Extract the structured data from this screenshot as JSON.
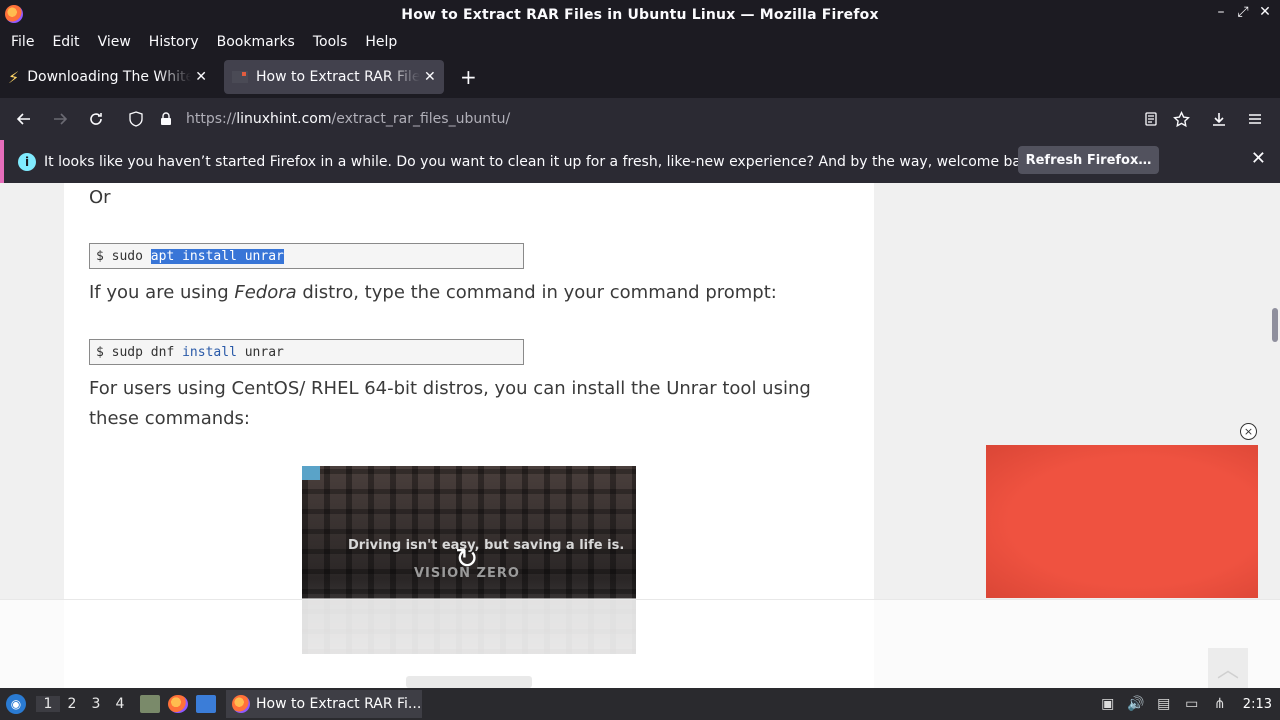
{
  "window": {
    "title": "How to Extract RAR Files in Ubuntu Linux — Mozilla Firefox",
    "buttons": {
      "minimize": "–",
      "maximize": "⤢",
      "close": "✕"
    }
  },
  "menubar": [
    "File",
    "Edit",
    "View",
    "History",
    "Bookmarks",
    "Tools",
    "Help"
  ],
  "tabs": [
    {
      "label": "Downloading The White House",
      "favicon": "bolt-icon",
      "active": false
    },
    {
      "label": "How to Extract RAR Files in Ubuntu",
      "favicon": "linuxhint-favicon",
      "active": true
    }
  ],
  "new_tab": "+",
  "url": {
    "scheme": "https://",
    "host": "linuxhint.com",
    "path": "/extract_rar_files_ubuntu/"
  },
  "notification": {
    "message": "It looks like you haven’t started Firefox in a while. Do you want to clean it up for a fresh, like-new experience? And by the way, welcome back!",
    "button": "Refresh Firefox…",
    "close": "✕"
  },
  "article": {
    "or_text": "Or",
    "code1": {
      "prompt": "$",
      "cmd": "sudo",
      "selected": "apt install unrar"
    },
    "fedora": {
      "before": "If you are using ",
      "italic": "Fedora",
      "after": " distro, type the command in your command prompt:"
    },
    "code2": {
      "prompt": "$",
      "cmd": "sudp dnf",
      "kw": "install",
      "arg": "unrar"
    },
    "centos_line1": "For users using CentOS/ RHEL 64-bit distros, you can install the Unrar tool using",
    "centos_line2": "these commands:"
  },
  "video": {
    "caption": "Driving isn't easy, but saving a life is.",
    "brand": "VISION ZERO",
    "replay": "↻"
  },
  "ad": {
    "close": "×",
    "color": "#e8493a"
  },
  "scroll_top": "︿",
  "taskbar": {
    "workspaces": [
      "1",
      "2",
      "3",
      "4"
    ],
    "task_label": "How to Extract RAR Fi...",
    "clock": "2:13"
  }
}
